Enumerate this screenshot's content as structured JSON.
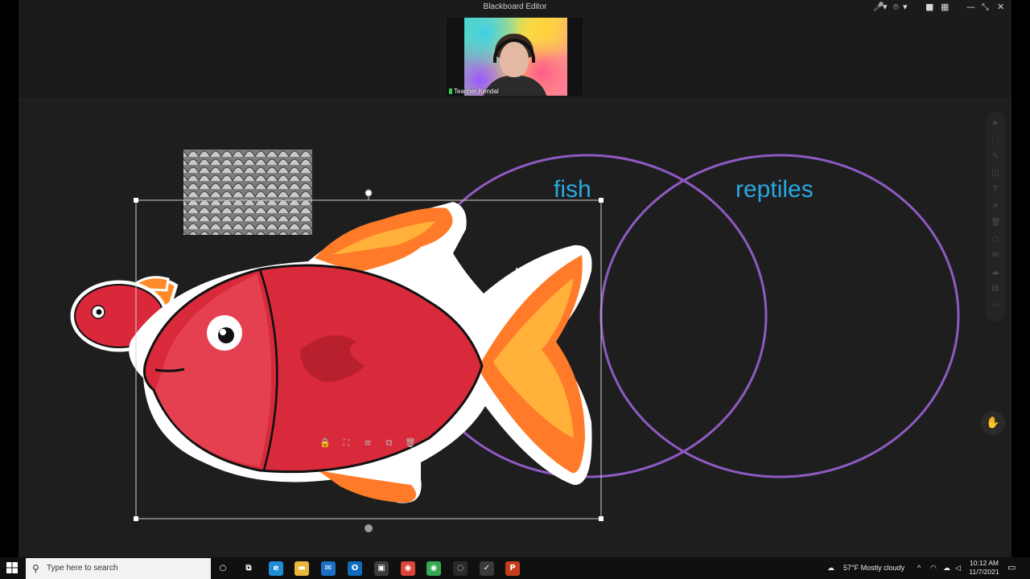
{
  "window": {
    "title": "Blackboard Editor",
    "controls": {
      "mic": "🎤",
      "mic_caret": "▾",
      "cam_mic": "⌾",
      "cam_caret": "▾",
      "camera": "■",
      "grid": "▦",
      "minimize": "—",
      "restore": "⤡",
      "close": "✕"
    }
  },
  "video": {
    "participant_name": "Teacher Kendal"
  },
  "venn": {
    "left_label": "fish",
    "right_label": "reptiles",
    "circle_color": "#8e5ac2",
    "label_color": "#29a8e0"
  },
  "side_tools": [
    {
      "icon": "pointer-icon",
      "glyph": "➤"
    },
    {
      "icon": "select-icon",
      "glyph": "⬚"
    },
    {
      "icon": "pen-icon",
      "glyph": "✎"
    },
    {
      "icon": "eraser-icon",
      "glyph": "◫"
    },
    {
      "icon": "text-icon",
      "glyph": "T"
    },
    {
      "icon": "tools-icon",
      "glyph": "✕"
    },
    {
      "icon": "trash-icon",
      "glyph": "🗑"
    },
    {
      "icon": "shapes-icon",
      "glyph": "○"
    },
    {
      "icon": "chat-icon",
      "glyph": "✉"
    },
    {
      "icon": "cloud-icon",
      "glyph": "☁"
    },
    {
      "icon": "briefcase-icon",
      "glyph": "▤"
    },
    {
      "icon": "people-icon",
      "glyph": "⚇"
    }
  ],
  "selection_tools": [
    {
      "icon": "lock-icon",
      "glyph": "🔒"
    },
    {
      "icon": "crop-icon",
      "glyph": "⛶"
    },
    {
      "icon": "layers-icon",
      "glyph": "≋"
    },
    {
      "icon": "duplicate-icon",
      "glyph": "⧉"
    },
    {
      "icon": "delete-icon",
      "glyph": "🗑"
    }
  ],
  "raise_hand": {
    "glyph": "✋",
    "icon": "raise-hand-icon"
  },
  "taskbar": {
    "search_placeholder": "Type here to search",
    "apps": [
      {
        "name": "cortana-icon",
        "glyph": "○",
        "color": "#101010"
      },
      {
        "name": "task-view-icon",
        "glyph": "⧉",
        "color": "#101010"
      },
      {
        "name": "edge-icon",
        "glyph": "e",
        "color": "#1e8fd6"
      },
      {
        "name": "file-explorer-icon",
        "glyph": "▬",
        "color": "#e8b63b"
      },
      {
        "name": "mail-icon",
        "glyph": "✉",
        "color": "#1b70c4"
      },
      {
        "name": "outlook-icon",
        "glyph": "O",
        "color": "#0f6cbd"
      },
      {
        "name": "store-icon",
        "glyph": "▣",
        "color": "#3d3d3d"
      },
      {
        "name": "chrome-icon",
        "glyph": "◉",
        "color": "#db4437"
      },
      {
        "name": "chrome-alt-icon",
        "glyph": "◉",
        "color": "#34a853"
      },
      {
        "name": "app-icon",
        "glyph": "◌",
        "color": "#2a2a2a"
      },
      {
        "name": "blackboard-icon",
        "glyph": "✓",
        "color": "#3a3a3a"
      },
      {
        "name": "powerpoint-icon",
        "glyph": "P",
        "color": "#c43e1c"
      }
    ],
    "weather": "57°F  Mostly cloudy",
    "time": "10:12 AM",
    "date": "11/7/2021"
  }
}
